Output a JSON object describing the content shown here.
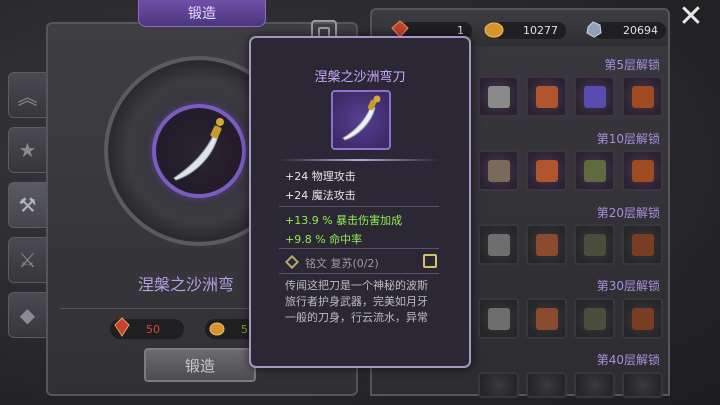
{
  "forge": {
    "tab_label": "锻造",
    "weapon_name": "涅槃之沙洲弯",
    "button_label": "锻造",
    "costs": [
      {
        "value": "50",
        "color": "#d64a3a"
      },
      {
        "value": "5",
        "color": "#6fb033"
      }
    ]
  },
  "resources": [
    {
      "name": "red-gem-icon",
      "value": "1"
    },
    {
      "name": "gold-coin-icon",
      "value": "10277"
    },
    {
      "name": "silver-ore-icon",
      "value": "20694"
    }
  ],
  "side_tabs": [
    {
      "name": "upgrade-tab",
      "glyph": "︽"
    },
    {
      "name": "star-tab",
      "glyph": "★"
    },
    {
      "name": "anvil-tab",
      "glyph": "⚒"
    },
    {
      "name": "weapon-tab",
      "glyph": "⚔"
    },
    {
      "name": "gem-tab",
      "glyph": "◆"
    }
  ],
  "grid": {
    "tiers": [
      {
        "label": "第5层解锁"
      },
      {
        "label": "第10层解锁"
      },
      {
        "label": "第20层解锁"
      },
      {
        "label": "第30层解锁"
      },
      {
        "label": "第40层解锁"
      }
    ]
  },
  "tooltip": {
    "title": "涅槃之沙洲弯刀",
    "stats": [
      "+24 物理攻击",
      "+24 魔法攻击"
    ],
    "bonuses": [
      "+13.9 % 暴击伤害加成",
      "+9.8 % 命中率"
    ],
    "rune": "铭文 复苏(0/2)",
    "description": "传闻这把刀是一个神秘的波斯旅行者护身武器，完美如月牙一般的刀身，行云流水，异常"
  },
  "colors": {
    "accent_purple": "#7d5cc0",
    "tier_label": "#a98fe0",
    "bonus_green": "#8df052"
  }
}
